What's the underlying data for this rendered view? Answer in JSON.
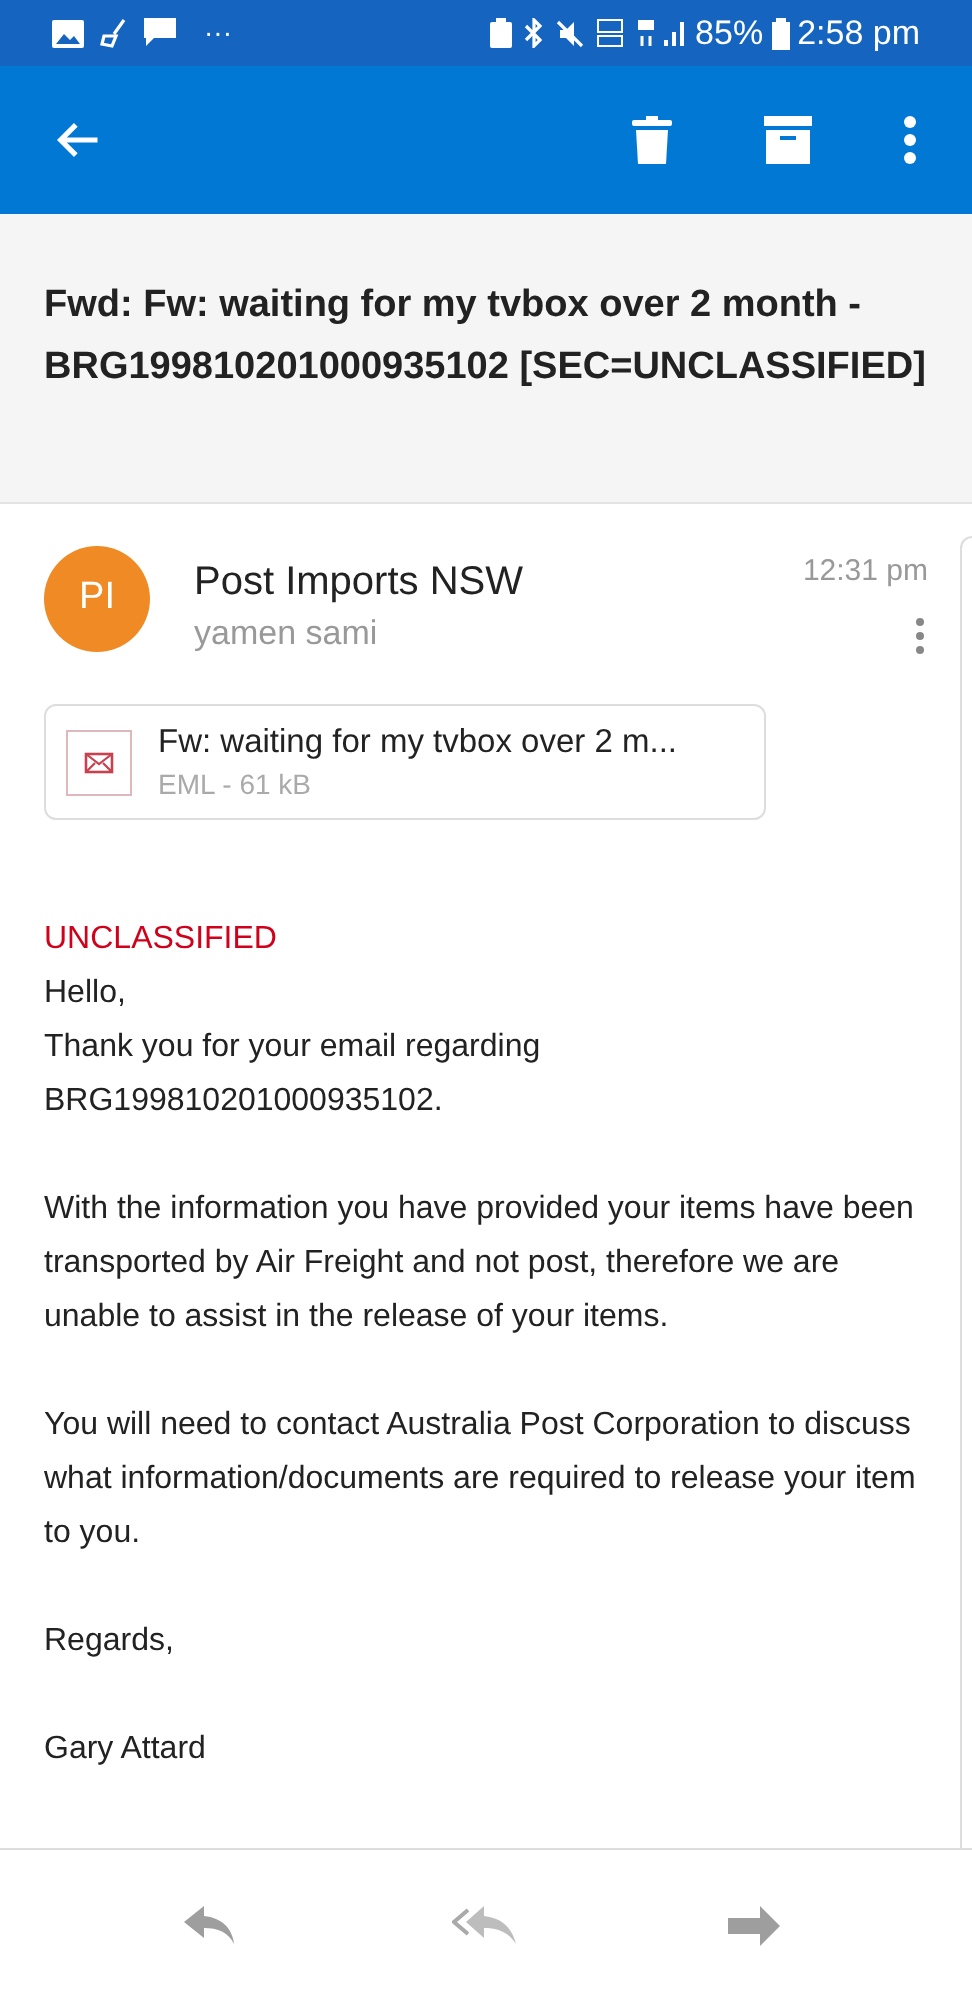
{
  "status_bar": {
    "battery": "85%",
    "time": "2:58 pm",
    "more": "···"
  },
  "subject": "Fwd: Fw: waiting for my tvbox over 2 month - BRG199810201000935102 [SEC=UNCLASSIFIED]",
  "message": {
    "avatar": "PI",
    "sender": "Post Imports NSW",
    "recipient": "yamen sami",
    "time": "12:31 pm"
  },
  "attachment": {
    "name": "Fw: waiting for my tvbox over 2 m...",
    "meta": "EML - 61 kB"
  },
  "classification": "UNCLASSIFIED",
  "body": [
    "Hello,",
    "Thank you for your email regarding BRG199810201000935102.",
    "With the information you have provided your items have been transported by Air Freight and not post, therefore we are unable to assist in the release of your items.",
    "You will need to contact Australia Post Corporation to discuss what information/documents are required to release your item to you.",
    "Regards,",
    "Gary Attard"
  ]
}
